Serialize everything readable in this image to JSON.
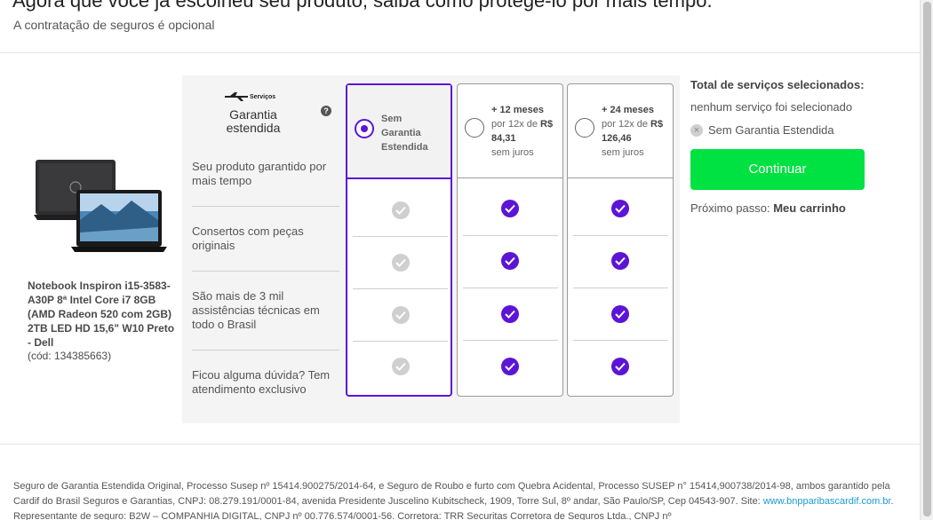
{
  "header": {
    "title": "Agora que você já escolheu seu produto, saiba como protegê-lo por mais tempo.",
    "subtitle": "A contratação de seguros é opcional"
  },
  "product": {
    "name": "Notebook Inspiron i15-3583-A30P 8ª Intel Core i7 8GB (AMD Radeon 520 com 2GB) 2TB LED HD 15,6\" W10 Preto - Dell",
    "code": "(cód: 134385663)"
  },
  "warranty": {
    "brand_label": "Serviços",
    "title_line1": "Garantia",
    "title_line2": "estendida",
    "help": "?",
    "features": [
      "Seu produto garantido por mais tempo",
      "Consertos com peças originais",
      "São mais de 3 mil assistências técnicas em todo o Brasil",
      "Ficou alguma dúvida? Tem atendimento exclusivo"
    ],
    "options": [
      {
        "line1": "Sem",
        "line2": "Garantia",
        "line3": "Estendida",
        "selected": true
      },
      {
        "term": "+ 12 meses",
        "price_prefix": "por 12x de",
        "currency": "R$",
        "price": "84,31",
        "note": "sem juros",
        "selected": false
      },
      {
        "term": "+ 24 meses",
        "price_prefix": "por 12x de",
        "currency": "R$",
        "price": "126,46",
        "note": "sem juros",
        "selected": false
      }
    ]
  },
  "summary": {
    "title": "Total de serviços selecionados:",
    "none": "nenhum serviço foi selecionado",
    "item": "Sem Garantia Estendida",
    "remove_glyph": "×",
    "continue_label": "Continuar",
    "next_prefix": "Próximo passo:",
    "next_target": "Meu carrinho"
  },
  "footer": {
    "text1": "Seguro de Garantia Estendida Original, Processo Susep nº 15414.900275/2014-64, e Seguro de Roubo e furto com Quebra Acidental, Processo SUSEP n° 15414,900738/2014-98, ambos garantido pela Cardif do Brasil Seguros e Garantias, CNPJ: 08.279.191/0001-84, avenida Presidente Juscelino Kubitscheck, 1909, Torre Sul, 8º andar, São Paulo/SP, Cep 04543-907. Site:",
    "link": "www.bnpparibascardif.com.br",
    "text2": ". Representante de seguro: B2W – COMPANHIA DIGITAL, CNPJ nº 00.776.574/0001-56. Corretora: TRR Securitas Corretora de Seguros Ltda., CNPJ nº"
  },
  "colors": {
    "accent": "#5c14d6",
    "continue": "#00e142",
    "link": "#1a9ad6"
  }
}
